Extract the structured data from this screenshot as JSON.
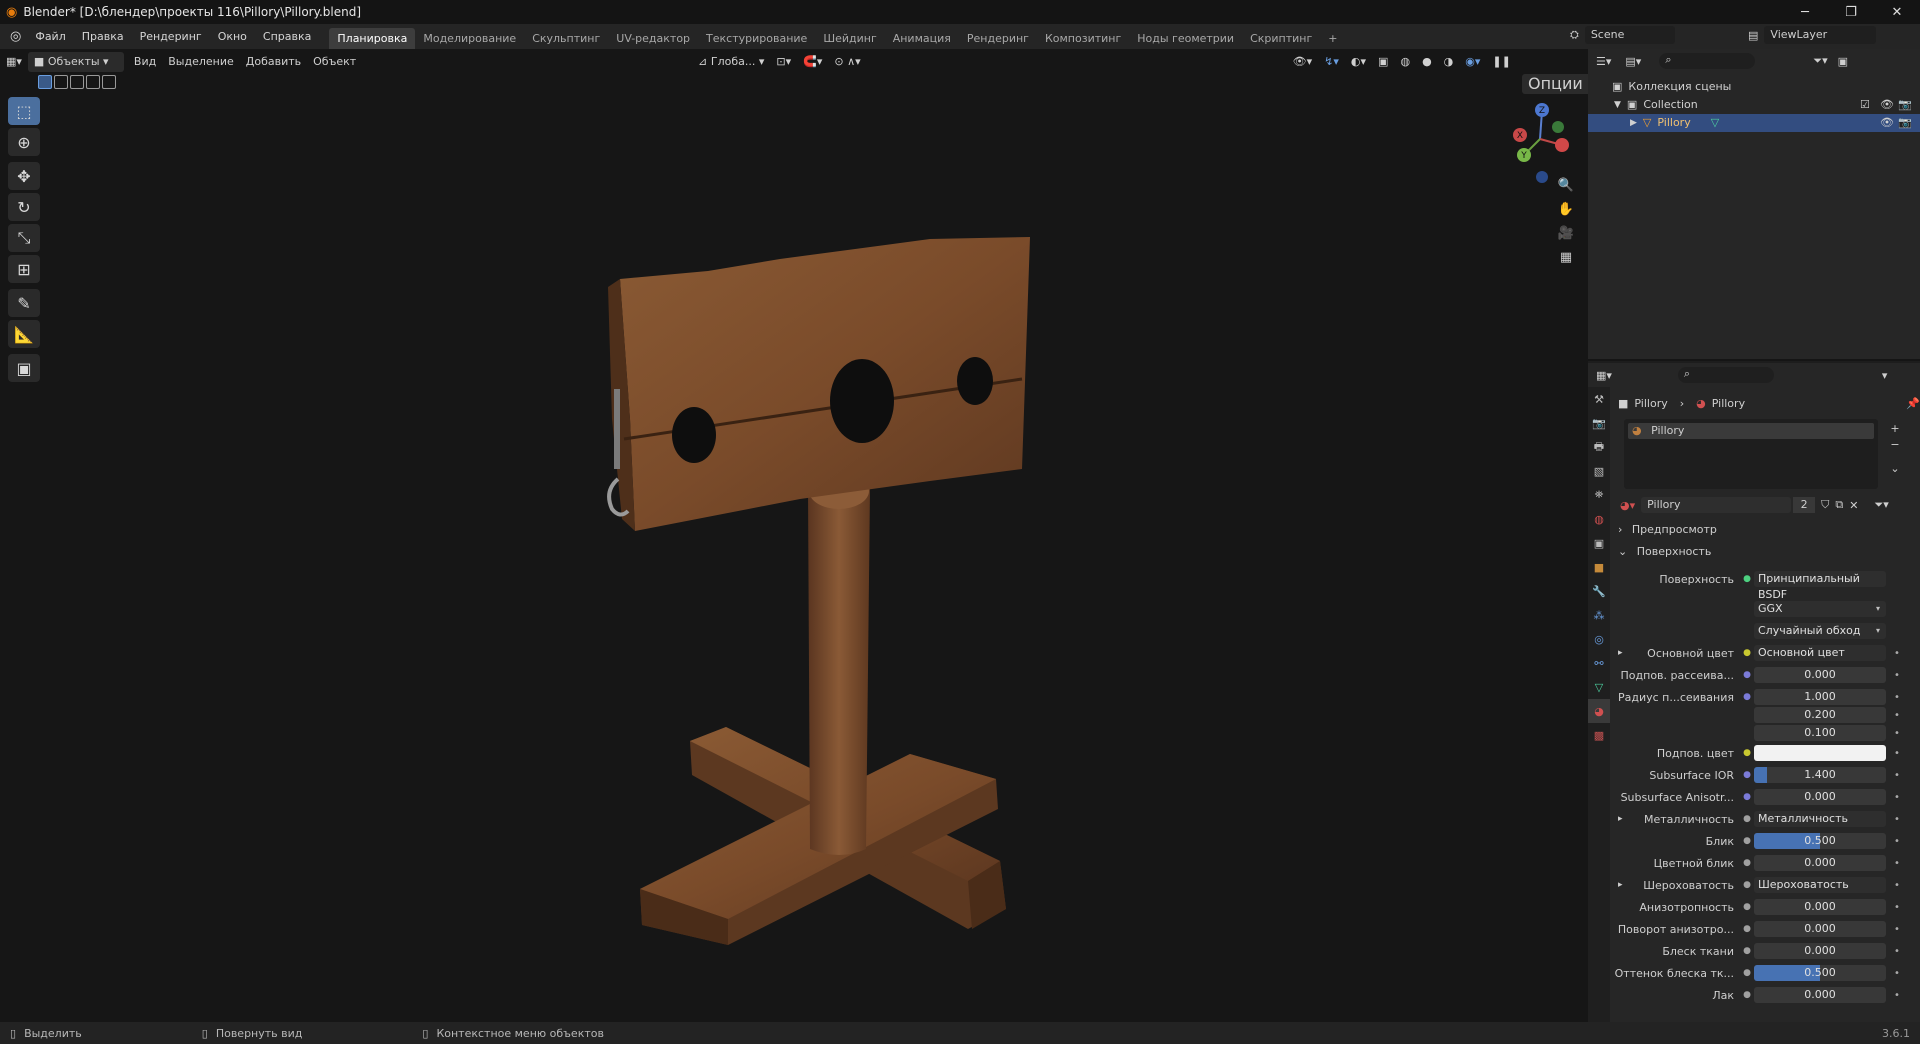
{
  "title_bar": {
    "title": "Blender* [D:\\блендер\\проекты 116\\Pillory\\Pillory.blend]"
  },
  "menu": {
    "items": [
      "Файл",
      "Правка",
      "Рендеринг",
      "Окно",
      "Справка"
    ]
  },
  "workspaces": {
    "tabs": [
      "Планировка",
      "Моделирование",
      "Скульптинг",
      "UV-редактор",
      "Текстурирование",
      "Шейдинг",
      "Анимация",
      "Рендеринг",
      "Композитинг",
      "Ноды геометрии",
      "Скриптинг"
    ],
    "active": "Планировка",
    "add": "+"
  },
  "top_right": {
    "scene": "Scene",
    "view_layer": "ViewLayer"
  },
  "viewport_header": {
    "mode": "Объекты",
    "menus": [
      "Вид",
      "Выделение",
      "Добавить",
      "Объект"
    ],
    "transform": "Глоба...",
    "options": "Опции"
  },
  "gizmo": {
    "x": "X",
    "y": "Y",
    "z": "Z"
  },
  "outliner": {
    "scene_collection": "Коллекция сцены",
    "collection": "Collection",
    "object": "Pillory"
  },
  "properties": {
    "breadcrumb": [
      "Pillory",
      "Pillory"
    ],
    "slot": "Pillory",
    "material_name": "Pillory",
    "users": "2",
    "preview_label": "Предпросмотр",
    "surface_panel": "Поверхность",
    "surface_label": "Поверхность",
    "surface_value": "Принципиальный BSDF",
    "distribution": "GGX",
    "subsurface_method": "Случайный обход",
    "rows": [
      {
        "label": "Основной цвет",
        "value": "Основной цвет",
        "kind": "link",
        "dot": "#c8c830",
        "expand": true
      },
      {
        "label": "Подпов. рассеива...",
        "value": "0.000",
        "kind": "num",
        "dot": "#7b7bd8"
      },
      {
        "label": "Радиус п...сеивания",
        "value": "1.000",
        "kind": "num",
        "dot": "#7b7bd8"
      },
      {
        "label": "",
        "value": "0.200",
        "kind": "num"
      },
      {
        "label": "",
        "value": "0.100",
        "kind": "num"
      },
      {
        "label": "Подпов. цвет",
        "value": "",
        "kind": "color",
        "dot": "#c8c830"
      },
      {
        "label": "Subsurface IOR",
        "value": "1.400",
        "kind": "num",
        "dot": "#7b7bd8",
        "fill": 0.1
      },
      {
        "label": "Subsurface Anisotr...",
        "value": "0.000",
        "kind": "num",
        "dot": "#7b7bd8"
      },
      {
        "label": "Металличность",
        "value": "Металличность",
        "kind": "link",
        "dot": "#a0a0a0",
        "expand": true
      },
      {
        "label": "Блик",
        "value": "0.500",
        "kind": "num",
        "dot": "#a0a0a0",
        "fill": 0.5
      },
      {
        "label": "Цветной блик",
        "value": "0.000",
        "kind": "num",
        "dot": "#a0a0a0"
      },
      {
        "label": "Шероховатость",
        "value": "Шероховатость",
        "kind": "link",
        "dot": "#a0a0a0",
        "expand": true
      },
      {
        "label": "Анизотропность",
        "value": "0.000",
        "kind": "num",
        "dot": "#a0a0a0"
      },
      {
        "label": "Поворот анизотро...",
        "value": "0.000",
        "kind": "num",
        "dot": "#a0a0a0"
      },
      {
        "label": "Блеск ткани",
        "value": "0.000",
        "kind": "num",
        "dot": "#a0a0a0"
      },
      {
        "label": "Оттенок блеска тк...",
        "value": "0.500",
        "kind": "num",
        "dot": "#a0a0a0",
        "fill": 0.5
      },
      {
        "label": "Лак",
        "value": "0.000",
        "kind": "num",
        "dot": "#a0a0a0"
      }
    ]
  },
  "status_bar": {
    "select": "Выделить",
    "rotate": "Повернуть вид",
    "context": "Контекстное меню объектов",
    "version": "3.6.1"
  },
  "colors": {
    "accent": "#4772b3",
    "active_tool": "#4b6f9e",
    "object_orange": "#f0a030"
  }
}
